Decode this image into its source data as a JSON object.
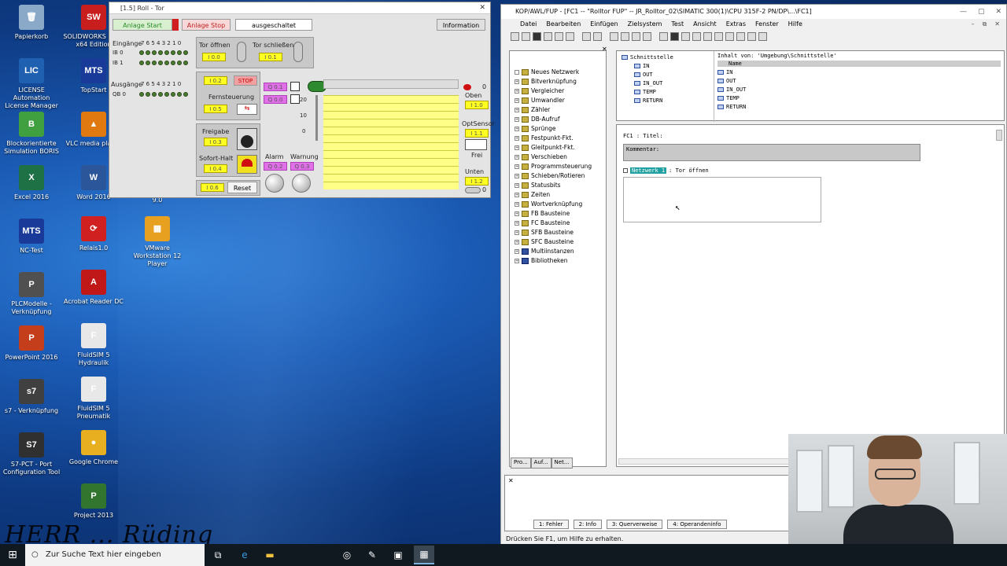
{
  "desktop": {
    "icons_col1": [
      {
        "label": "Papierkorb",
        "icon": "recycle-bin-icon",
        "color": "#8aa8c8",
        "glyph": "🗑"
      },
      {
        "label": "LICENSE Automation License Manager",
        "icon": "license-icon",
        "color": "#2060b0",
        "glyph": "LIC"
      },
      {
        "label": "Blockorientierte Simulation BORIS",
        "icon": "boris-icon",
        "color": "#40a040",
        "glyph": "B"
      },
      {
        "label": "Excel 2016",
        "icon": "excel-icon",
        "color": "#1e7145",
        "glyph": "X"
      },
      {
        "label": "NC-Test",
        "icon": "mts-icon",
        "color": "#1a3a9a",
        "glyph": "MTS"
      },
      {
        "label": "PLCModelle - Verknüpfung",
        "icon": "plc-icon",
        "color": "#505050",
        "glyph": "P"
      },
      {
        "label": "PowerPoint 2016",
        "icon": "powerpoint-icon",
        "color": "#c43e1c",
        "glyph": "P"
      },
      {
        "label": "s7 - Verknüpfung",
        "icon": "s7-icon",
        "color": "#404040",
        "glyph": "s7"
      },
      {
        "label": "S7-PCT - Port Configuration Tool",
        "icon": "s7pct-icon",
        "color": "#303030",
        "glyph": "S7"
      }
    ],
    "icons_col2": [
      {
        "label": "SOLIDWORKS 2016 x64 Edition",
        "icon": "solidworks-icon",
        "color": "#c81e1e",
        "glyph": "SW"
      },
      {
        "label": "TopStart",
        "icon": "topstart-icon",
        "color": "#1a3a9a",
        "glyph": "MTS"
      },
      {
        "label": "VLC media player",
        "icon": "vlc-icon",
        "color": "#e07a10",
        "glyph": "▲"
      },
      {
        "label": "Word 2016",
        "icon": "word-icon",
        "color": "#2b579a",
        "glyph": "W"
      },
      {
        "label": "Relais1.0",
        "icon": "relais-icon",
        "color": "#d02020",
        "glyph": "⟳"
      },
      {
        "label": "Acrobat Reader DC",
        "icon": "acrobat-icon",
        "color": "#c01818",
        "glyph": "A"
      },
      {
        "label": "FluidSIM 5 Hydraulik",
        "icon": "fluidsim-icon",
        "color": "#e8e8e8",
        "glyph": "F"
      },
      {
        "label": "FluidSIM 5 Pneumatik",
        "icon": "fluidsim-icon",
        "color": "#e8e8e8",
        "glyph": "F"
      },
      {
        "label": "Google Chrome",
        "icon": "chrome-icon",
        "color": "#e8b020",
        "glyph": "●"
      },
      {
        "label": "Project 2013",
        "icon": "project-icon",
        "color": "#31752f",
        "glyph": "P"
      }
    ],
    "vmware": {
      "label": "VMware Workstation 12 Player",
      "sublabel": "9.0"
    },
    "watermark": "HERR ... Rüding"
  },
  "taskbar": {
    "search_placeholder": "Zur Suche Text hier eingeben"
  },
  "roll_window": {
    "title": "[1.5] Roll - Tor",
    "close": "✕",
    "anlage_start": "Anlage Start",
    "anlage_stop": "Anlage Stop",
    "status": "ausgeschaltet",
    "information": "Information",
    "eingaenge_label": "Eingänge",
    "ausgaenge_label": "Ausgänge",
    "bit_header": "7 6 5 4 3 2 1 0",
    "ib0": "IB 0",
    "ib1": "IB 1",
    "qb0": "QB 0",
    "tor_oeffnen": "Tor öffnen",
    "tor_schliessen": "Tor schließen",
    "lamp_i00": "I 0.0",
    "lamp_i01": "I 0.1",
    "lamp_i02": "I 0.2",
    "stop_btn": "STOP",
    "fernsteuerung": "Fernsteuerung",
    "lamp_i05": "I 0.5",
    "freigabe": "Freigabe",
    "lamp_i03": "I 0.3",
    "sofort_halt": "Sofort-Halt",
    "lamp_i04": "I 0.4",
    "lamp_i06": "I 0.6",
    "reset": "Reset",
    "q01": "Q 0.1",
    "q00": "Q 0.0",
    "alarm": "Alarm",
    "warnung": "Warnung",
    "q02": "Q 0.2",
    "q03": "Q 0.3",
    "scale_20": "20",
    "scale_10": "10",
    "scale_0": "0",
    "oben": "Oben",
    "lamp_i10": "I 1.0",
    "opt_sensor": "OptSensor",
    "lamp_i11": "I 1.1",
    "frei": "Frei",
    "unten": "Unten",
    "lamp_i12": "I 1.2",
    "zero1": "0",
    "zero2": "0"
  },
  "kop_window": {
    "title": "KOP/AWL/FUP - [FC1 -- \"Rolltor FUP\" -- JR_Rolltor_02\\SIMATIC 300(1)\\CPU 315F-2 PN/DP\\...\\FC1]",
    "menu": [
      "Datei",
      "Bearbeiten",
      "Einfügen",
      "Zielsystem",
      "Test",
      "Ansicht",
      "Extras",
      "Fenster",
      "Hilfe"
    ],
    "catalog": [
      {
        "label": "Neues Netzwerk",
        "lib": false
      },
      {
        "label": "Bitverknüpfung",
        "lib": false
      },
      {
        "label": "Vergleicher",
        "lib": false
      },
      {
        "label": "Umwandler",
        "lib": false
      },
      {
        "label": "Zähler",
        "lib": false
      },
      {
        "label": "DB-Aufruf",
        "lib": false
      },
      {
        "label": "Sprünge",
        "lib": false
      },
      {
        "label": "Festpunkt-Fkt.",
        "lib": false
      },
      {
        "label": "Gleitpunkt-Fkt.",
        "lib": false
      },
      {
        "label": "Verschieben",
        "lib": false
      },
      {
        "label": "Programmsteuerung",
        "lib": false
      },
      {
        "label": "Schieben/Rotieren",
        "lib": false
      },
      {
        "label": "Statusbits",
        "lib": false
      },
      {
        "label": "Zeiten",
        "lib": false
      },
      {
        "label": "Wortverknüpfung",
        "lib": false
      },
      {
        "label": "FB Bausteine",
        "lib": false
      },
      {
        "label": "FC Bausteine",
        "lib": false
      },
      {
        "label": "SFB Bausteine",
        "lib": false
      },
      {
        "label": "SFC Bausteine",
        "lib": false
      },
      {
        "label": "Multiinstanzen",
        "lib": true
      },
      {
        "label": "Bibliotheken",
        "lib": true
      }
    ],
    "cat_tabs": [
      "Pro...",
      "Auf...",
      "Net..."
    ],
    "iface_tree": [
      "Schnittstelle",
      "IN",
      "OUT",
      "IN_OUT",
      "TEMP",
      "RETURN"
    ],
    "iface_content_label": "Inhalt von: 'Umgebung\\Schnittstelle'",
    "iface_name_header": "Name",
    "iface_list": [
      "IN",
      "OUT",
      "IN_OUT",
      "TEMP",
      "RETURN"
    ],
    "fc_title": "FC1 : Titel:",
    "kommentar": "Kommentar:",
    "netzwerk_label": "Netzwerk 1",
    "netzwerk_title": ": Tor öffnen",
    "bottom_tabs": [
      "1: Fehler",
      "2: Info",
      "3: Querverweise",
      "4: Operandeninfo"
    ],
    "status": "Drücken Sie F1, um Hilfe zu erhalten."
  }
}
